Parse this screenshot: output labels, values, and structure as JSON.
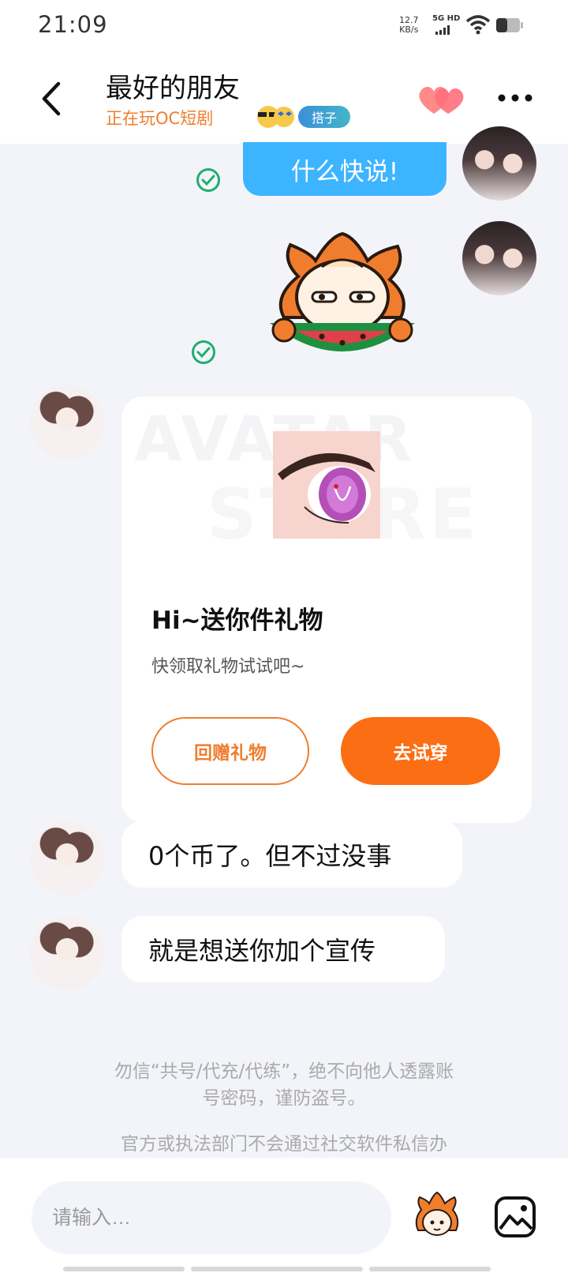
{
  "status_bar": {
    "time": "21:09",
    "net_speed_value": "12.7",
    "net_speed_unit": "KB/s",
    "network": "5G HD",
    "icons": [
      "signal-icon",
      "wifi-icon",
      "battery-icon"
    ]
  },
  "header": {
    "title": "最好的朋友",
    "subtitle": "正在玩OC短剧",
    "tag": "搭子",
    "icons": [
      "back-arrow-icon",
      "hearts-icon",
      "more-icon"
    ]
  },
  "messages": {
    "outgoing_text": "什么快说!",
    "gift_card": {
      "watermark_line1": "AVATAR",
      "watermark_line2": "STORE",
      "title": "Hi~送你件礼物",
      "subtitle": "快领取礼物试试吧~",
      "return_gift_label": "回赠礼物",
      "try_on_label": "去试穿"
    },
    "incoming": [
      "0个币了。但不过没事",
      "就是想送你加个宣传"
    ],
    "notice_line1": "勿信“共号/代充/代练”，绝不向他人透露账",
    "notice_line2": "号密码，谨防盗号。",
    "notice_line3": "官方或执法部门不会通过社交软件私信办"
  },
  "input_bar": {
    "placeholder": "请输入…"
  },
  "colors": {
    "accent_orange": "#fb6e14",
    "bubble_blue": "#3db4ff",
    "check_green": "#1fae6e",
    "background": "#f3f4f9"
  }
}
